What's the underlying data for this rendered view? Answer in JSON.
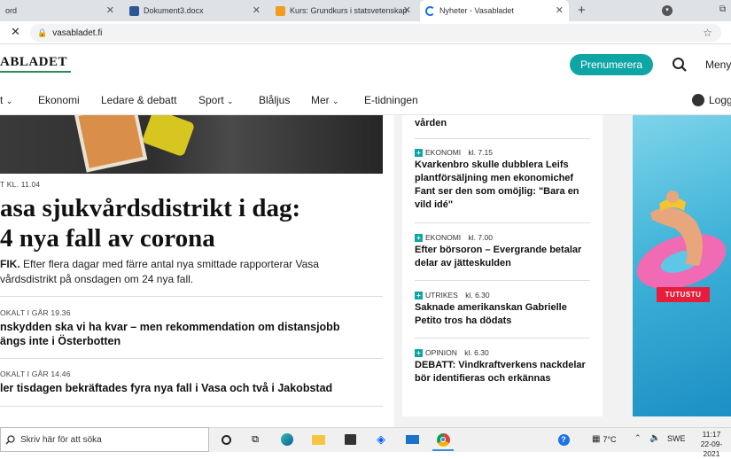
{
  "browser": {
    "tabs": [
      {
        "label": "ord",
        "active": false
      },
      {
        "label": "Dokument3.docx",
        "active": false
      },
      {
        "label": "Kurs: Grundkurs i statsvetenskap",
        "active": false
      },
      {
        "label": "Nyheter - Vasabladet",
        "active": true
      }
    ],
    "new_tab_symbol": "+",
    "url": "vasabladet.fi"
  },
  "site": {
    "logo": "ABLADET",
    "subscribe_label": "Prenumerera",
    "menu_label": "Meny",
    "login_label": "Logg"
  },
  "nav": {
    "items": [
      "t",
      "Ekonomi",
      "Ledare & debatt",
      "Sport",
      "Blåljus",
      "Mer",
      "E-tidningen"
    ]
  },
  "main": {
    "lead": {
      "meta": "T  KL. 11.04",
      "headline_line1": "asa sjukvårdsdistrikt i dag:",
      "headline_line2": "4 nya fall av corona",
      "ingress_bold": "FIK.",
      "ingress_line1": "Efter flera dagar med färre antal nya smittade rapporterar Vasa",
      "ingress_line2": "vårdsdistrikt på onsdagen om 24 nya fall."
    },
    "articles": [
      {
        "meta": "OKALT  I GÅR 19.36",
        "title_line1": "nskydden ska vi ha kvar – men rekommendation om distansjobb",
        "title_line2": "ängs inte i Österbotten"
      },
      {
        "meta": "OKALT  I GÅR 14.46",
        "title_line1": "ler tisdagen bekräftades fyra nya fall i Vasa och två i Jakobstad",
        "title_line2": ""
      }
    ]
  },
  "sidebar": {
    "top_fragment": "vården",
    "items": [
      {
        "category": "EKONOMI",
        "time": "kl. 7.15",
        "title": "Kvarkenbro skulle dubblera Leifs plantförsäljning men ekonomichef Fant ser den som omöjlig: \"Bara en vild idé\""
      },
      {
        "category": "EKONOMI",
        "time": "kl. 7.00",
        "title": "Efter börsoron – Evergrande betalar delar av jätteskulden"
      },
      {
        "category": "UTRIKES",
        "time": "kl. 6.30",
        "title": "Saknade amerikanskan Gabrielle Petito tros ha dödats"
      },
      {
        "category": "OPINION",
        "time": "kl. 6.30",
        "title": "DEBATT: Vindkraftverkens nackdelar bör identifieras och erkännas"
      }
    ]
  },
  "ad": {
    "button_label": "TUTUSTU"
  },
  "taskbar": {
    "search_placeholder": "Skriv här för att söka",
    "temperature": "7°C",
    "language": "SWE",
    "time": "11:17",
    "date": "22-09-2021"
  },
  "colors": {
    "accent": "#10a5a5",
    "logo_underline": "#2e8b57",
    "ad_button": "#e61e3c"
  }
}
